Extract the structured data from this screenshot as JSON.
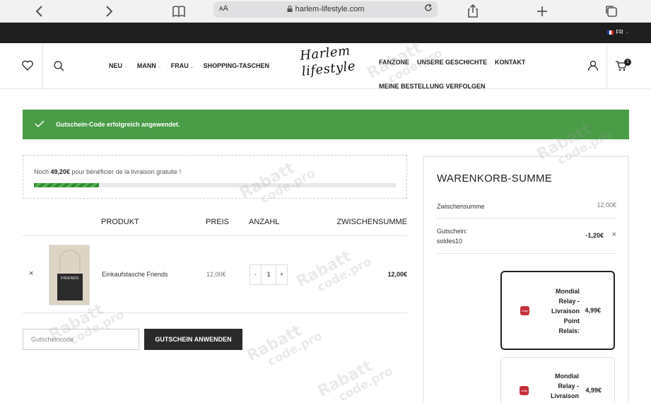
{
  "browser": {
    "text_size_label": "ᴀA",
    "url": "harlem-lifestyle.com"
  },
  "topbar": {
    "language": "FR",
    "flag_colors": [
      "#1f3fa6",
      "#ffffff",
      "#e0262a"
    ]
  },
  "header": {
    "nav_left": [
      {
        "label": "NEU",
        "has_dropdown": true
      },
      {
        "label": "MANN",
        "has_dropdown": true
      },
      {
        "label": "FRAU",
        "has_dropdown": true
      },
      {
        "label": "SHOPPING-TASCHEN",
        "has_dropdown": false
      }
    ],
    "logo_line1": "Harlem",
    "logo_line2": "lifestyle",
    "nav_right": [
      "FANZONE",
      "UNSERE GESCHICHTE",
      "KONTAKT",
      "MEINE BESTELLUNG VERFOLGEN"
    ],
    "cart_count": "1",
    "icons": [
      "heart-icon",
      "search-icon",
      "user-icon",
      "cart-icon"
    ]
  },
  "notice": {
    "message": "Gutschein-Code erfolgreich angewendet.",
    "color": "#4a9c47"
  },
  "shipping_threshold": {
    "prefix": "Noch ",
    "amount": "49,20€",
    "suffix": " pour bénéficier de la livraison gratuite !",
    "progress_fraction": 0.18
  },
  "cart": {
    "headers": {
      "product": "PRODUKT",
      "price": "PREIS",
      "quantity": "ANZAHL",
      "subtotal": "ZWISCHENSUMME"
    },
    "items": [
      {
        "remove_symbol": "×",
        "name": "Einkaufstasche Friends",
        "image_text": "FRIENDS",
        "price": "12,00€",
        "minus": "-",
        "quantity": "1",
        "plus": "+",
        "subtotal": "12,00€"
      }
    ],
    "coupon_placeholder": "Gutscheincode",
    "coupon_button": "GUTSCHEIN ANWENDEN"
  },
  "totals": {
    "title": "WARENKORB-SUMME",
    "subtotal_label": "Zwischensumme",
    "subtotal_value": "12,00€",
    "coupon_label_line1": "Gutschein:",
    "coupon_label_line2": "soldes10",
    "coupon_value": "-1,20€",
    "coupon_remove": "×",
    "shipping_options": [
      {
        "name_lines": [
          "Mondial",
          "Relay -",
          "Livraison",
          "Point",
          "Relais:"
        ],
        "price": "4,99€",
        "selected": true,
        "logo_text": "relay"
      },
      {
        "name_lines": [
          "Mondial",
          "Relay -",
          "Livraison"
        ],
        "price": "4,99€",
        "selected": false,
        "logo_text": "relay"
      }
    ]
  },
  "watermark": {
    "line1": "Rabatt",
    "line2": "code.pro"
  }
}
